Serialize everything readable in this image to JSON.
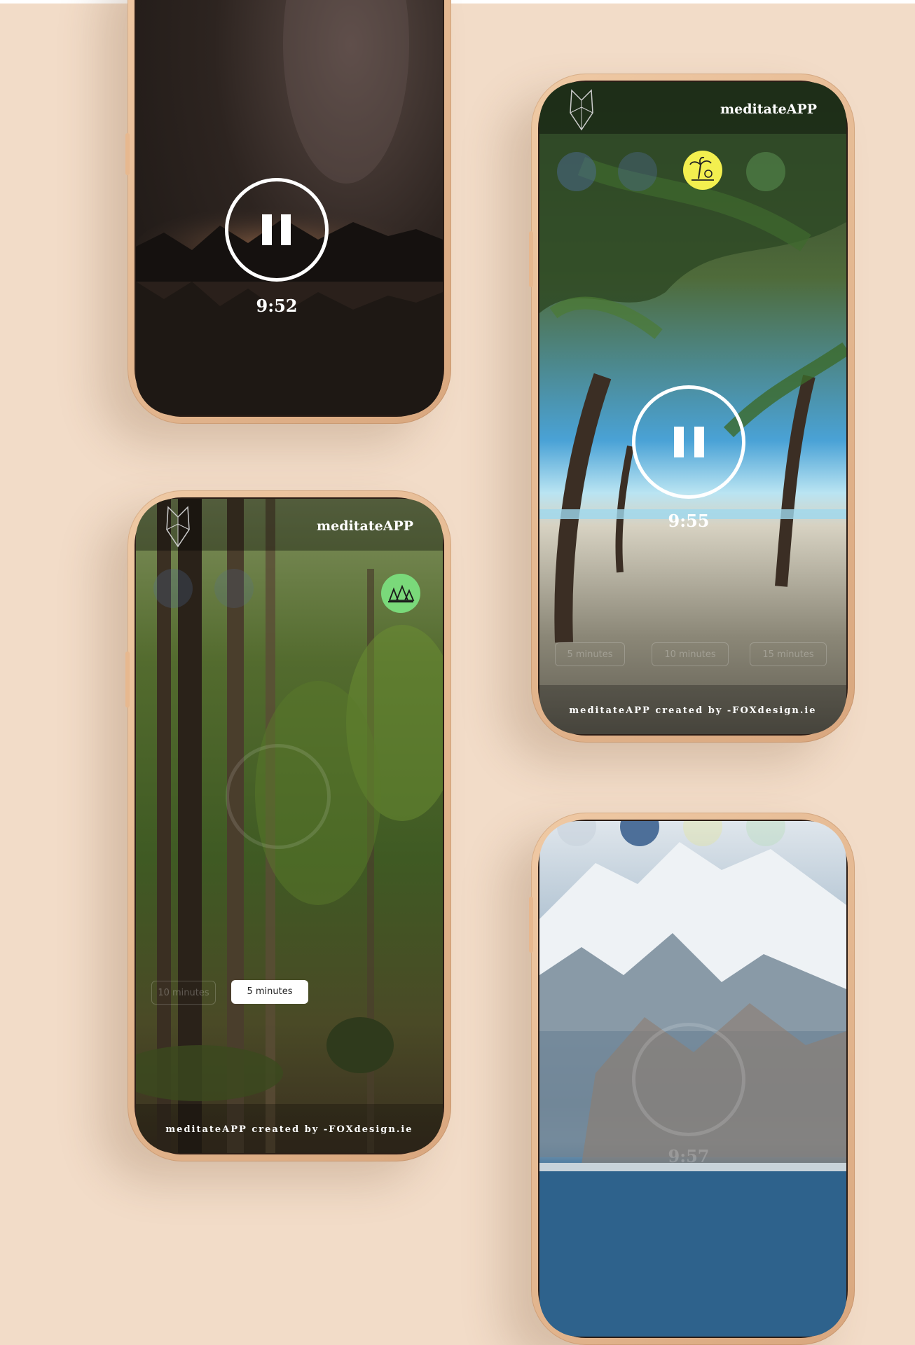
{
  "phone1": {
    "timer": "9:52"
  },
  "phone2": {
    "brand": "meditateAPP",
    "timer": "9:55",
    "footer": "meditateAPP created by -FOXdesign.ie",
    "durations": [
      "5 minutes",
      "10 minutes",
      "15 minutes"
    ]
  },
  "phone3": {
    "brand": "meditateAPP",
    "selected_duration": "5 minutes",
    "durations": [
      "5 minutes",
      "10 minutes"
    ],
    "footer": "meditateAPP created by -FOXdesign.ie"
  },
  "phone4": {
    "timer": "9:57"
  },
  "colors": {
    "background": "#f2dcc8",
    "accent_yellow": "#f3ef4f",
    "accent_green": "#7ad97a"
  }
}
